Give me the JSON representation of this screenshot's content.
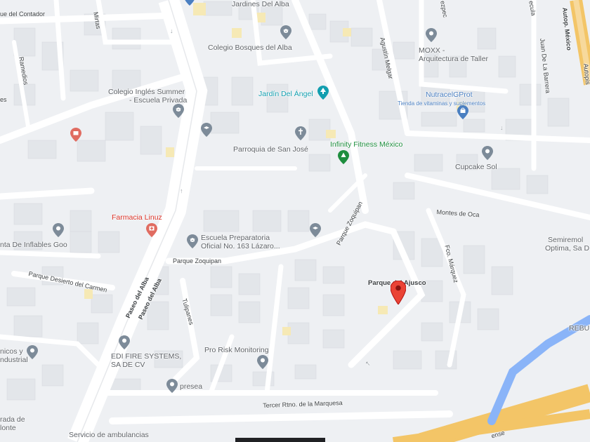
{
  "map": {
    "colors": {
      "land": "#eef0f3",
      "road": "#ffffff",
      "building": "#e3e6ea",
      "highway": "#f3c567",
      "river": "#8ab4f8",
      "pin_gray": "#7d8b99",
      "pin_red": "#ea4335"
    },
    "places": [
      {
        "name": "Jardines Del Alba",
        "category": "area"
      },
      {
        "name": "Colegio Bosques del Alba",
        "category": "school",
        "icon": "school-pin-icon"
      },
      {
        "name": "MOXX -",
        "category": "business",
        "icon": "place-pin-icon"
      },
      {
        "name": "Arquitectura de Taller",
        "category": "business"
      },
      {
        "name": "Jardín Del Ángel",
        "category": "park",
        "icon": "park-pin-icon"
      },
      {
        "name": "NutracelGProt",
        "category": "shop",
        "icon": "shop-pin-icon"
      },
      {
        "name": "Tienda de vitaminas y suplementos",
        "category": "shop-subtitle"
      },
      {
        "name": "Colegio Inglés Summer",
        "category": "school",
        "icon": "school-pin-icon"
      },
      {
        "name": "- Escuela Privada",
        "category": "school"
      },
      {
        "name": "Parroquia de San José",
        "category": "church",
        "icon": "church-pin-icon"
      },
      {
        "name": "Infinity Fitness México",
        "category": "gym",
        "icon": "gym-pin-icon"
      },
      {
        "name": "Cupcake Sol",
        "category": "business",
        "icon": "place-pin-icon"
      },
      {
        "name": "Farmacia Linuz",
        "category": "pharmacy",
        "icon": "pharmacy-pin-icon"
      },
      {
        "name": "Escuela Preparatoria",
        "category": "school",
        "icon": "school-pin-icon"
      },
      {
        "name": "Oficial No. 163 Lázaro...",
        "category": "school"
      },
      {
        "name": "nta De Inflables Goo",
        "category": "business",
        "icon": "place-pin-icon"
      },
      {
        "name": "Semiremol",
        "category": "business"
      },
      {
        "name": "Optima, Sa D",
        "category": "business"
      },
      {
        "name": "Parque del Ajusco",
        "category": "selected",
        "icon": "selected-location-pin-icon"
      },
      {
        "name": "EDI FIRE SYSTEMS,",
        "category": "business",
        "icon": "place-pin-icon"
      },
      {
        "name": "SA DE CV",
        "category": "business"
      },
      {
        "name": "Pro Risk Monitoring",
        "category": "business",
        "icon": "place-pin-icon"
      },
      {
        "name": "presea",
        "category": "business",
        "icon": "place-pin-icon"
      },
      {
        "name": "nicos y",
        "category": "business",
        "icon": "place-pin-icon"
      },
      {
        "name": "ndustrial",
        "category": "business"
      },
      {
        "name": "rada de",
        "category": "business"
      },
      {
        "name": "lonte",
        "category": "business"
      },
      {
        "name": "Servicio de ambulancias",
        "category": "business"
      },
      {
        "name": "REBU",
        "category": "area"
      }
    ],
    "streets": [
      "ue del Contador",
      "Mirtas",
      "Ramedios",
      "es",
      "Agustín Melgar",
      "Juan De La Barrera",
      "Autop. México",
      "Autopis",
      "Montes de Oca",
      "Parque Zoquipan",
      "Parque Zoquipan",
      "Parque Desierto del Carmen",
      "Paseo del Alba",
      "Paseo del Alba",
      "Tulipanes",
      "Fco. Márquez",
      "Tercer Rtno. de la Marquesa",
      "ense",
      "ezpec",
      "ecula"
    ]
  }
}
